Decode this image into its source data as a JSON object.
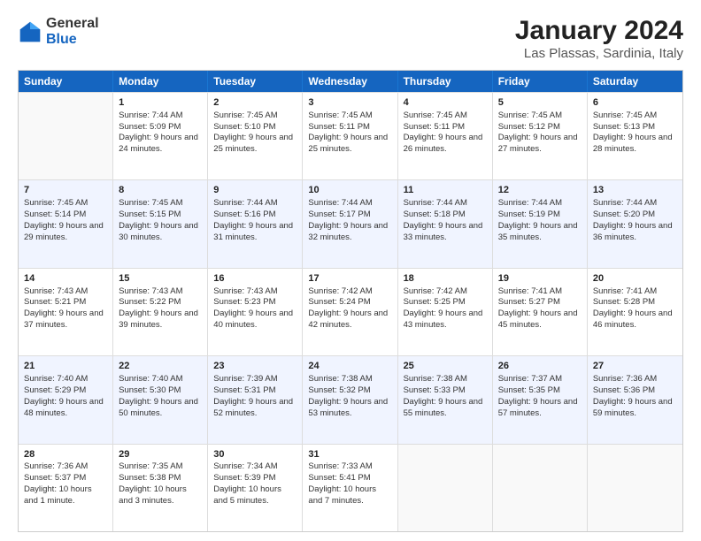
{
  "logo": {
    "general": "General",
    "blue": "Blue"
  },
  "title": "January 2024",
  "subtitle": "Las Plassas, Sardinia, Italy",
  "days": [
    "Sunday",
    "Monday",
    "Tuesday",
    "Wednesday",
    "Thursday",
    "Friday",
    "Saturday"
  ],
  "weeks": [
    [
      {
        "num": "",
        "empty": true
      },
      {
        "num": "1",
        "sunrise": "Sunrise: 7:44 AM",
        "sunset": "Sunset: 5:09 PM",
        "daylight": "Daylight: 9 hours and 24 minutes."
      },
      {
        "num": "2",
        "sunrise": "Sunrise: 7:45 AM",
        "sunset": "Sunset: 5:10 PM",
        "daylight": "Daylight: 9 hours and 25 minutes."
      },
      {
        "num": "3",
        "sunrise": "Sunrise: 7:45 AM",
        "sunset": "Sunset: 5:11 PM",
        "daylight": "Daylight: 9 hours and 25 minutes."
      },
      {
        "num": "4",
        "sunrise": "Sunrise: 7:45 AM",
        "sunset": "Sunset: 5:11 PM",
        "daylight": "Daylight: 9 hours and 26 minutes."
      },
      {
        "num": "5",
        "sunrise": "Sunrise: 7:45 AM",
        "sunset": "Sunset: 5:12 PM",
        "daylight": "Daylight: 9 hours and 27 minutes."
      },
      {
        "num": "6",
        "sunrise": "Sunrise: 7:45 AM",
        "sunset": "Sunset: 5:13 PM",
        "daylight": "Daylight: 9 hours and 28 minutes."
      }
    ],
    [
      {
        "num": "7",
        "sunrise": "Sunrise: 7:45 AM",
        "sunset": "Sunset: 5:14 PM",
        "daylight": "Daylight: 9 hours and 29 minutes."
      },
      {
        "num": "8",
        "sunrise": "Sunrise: 7:45 AM",
        "sunset": "Sunset: 5:15 PM",
        "daylight": "Daylight: 9 hours and 30 minutes."
      },
      {
        "num": "9",
        "sunrise": "Sunrise: 7:44 AM",
        "sunset": "Sunset: 5:16 PM",
        "daylight": "Daylight: 9 hours and 31 minutes."
      },
      {
        "num": "10",
        "sunrise": "Sunrise: 7:44 AM",
        "sunset": "Sunset: 5:17 PM",
        "daylight": "Daylight: 9 hours and 32 minutes."
      },
      {
        "num": "11",
        "sunrise": "Sunrise: 7:44 AM",
        "sunset": "Sunset: 5:18 PM",
        "daylight": "Daylight: 9 hours and 33 minutes."
      },
      {
        "num": "12",
        "sunrise": "Sunrise: 7:44 AM",
        "sunset": "Sunset: 5:19 PM",
        "daylight": "Daylight: 9 hours and 35 minutes."
      },
      {
        "num": "13",
        "sunrise": "Sunrise: 7:44 AM",
        "sunset": "Sunset: 5:20 PM",
        "daylight": "Daylight: 9 hours and 36 minutes."
      }
    ],
    [
      {
        "num": "14",
        "sunrise": "Sunrise: 7:43 AM",
        "sunset": "Sunset: 5:21 PM",
        "daylight": "Daylight: 9 hours and 37 minutes."
      },
      {
        "num": "15",
        "sunrise": "Sunrise: 7:43 AM",
        "sunset": "Sunset: 5:22 PM",
        "daylight": "Daylight: 9 hours and 39 minutes."
      },
      {
        "num": "16",
        "sunrise": "Sunrise: 7:43 AM",
        "sunset": "Sunset: 5:23 PM",
        "daylight": "Daylight: 9 hours and 40 minutes."
      },
      {
        "num": "17",
        "sunrise": "Sunrise: 7:42 AM",
        "sunset": "Sunset: 5:24 PM",
        "daylight": "Daylight: 9 hours and 42 minutes."
      },
      {
        "num": "18",
        "sunrise": "Sunrise: 7:42 AM",
        "sunset": "Sunset: 5:25 PM",
        "daylight": "Daylight: 9 hours and 43 minutes."
      },
      {
        "num": "19",
        "sunrise": "Sunrise: 7:41 AM",
        "sunset": "Sunset: 5:27 PM",
        "daylight": "Daylight: 9 hours and 45 minutes."
      },
      {
        "num": "20",
        "sunrise": "Sunrise: 7:41 AM",
        "sunset": "Sunset: 5:28 PM",
        "daylight": "Daylight: 9 hours and 46 minutes."
      }
    ],
    [
      {
        "num": "21",
        "sunrise": "Sunrise: 7:40 AM",
        "sunset": "Sunset: 5:29 PM",
        "daylight": "Daylight: 9 hours and 48 minutes."
      },
      {
        "num": "22",
        "sunrise": "Sunrise: 7:40 AM",
        "sunset": "Sunset: 5:30 PM",
        "daylight": "Daylight: 9 hours and 50 minutes."
      },
      {
        "num": "23",
        "sunrise": "Sunrise: 7:39 AM",
        "sunset": "Sunset: 5:31 PM",
        "daylight": "Daylight: 9 hours and 52 minutes."
      },
      {
        "num": "24",
        "sunrise": "Sunrise: 7:38 AM",
        "sunset": "Sunset: 5:32 PM",
        "daylight": "Daylight: 9 hours and 53 minutes."
      },
      {
        "num": "25",
        "sunrise": "Sunrise: 7:38 AM",
        "sunset": "Sunset: 5:33 PM",
        "daylight": "Daylight: 9 hours and 55 minutes."
      },
      {
        "num": "26",
        "sunrise": "Sunrise: 7:37 AM",
        "sunset": "Sunset: 5:35 PM",
        "daylight": "Daylight: 9 hours and 57 minutes."
      },
      {
        "num": "27",
        "sunrise": "Sunrise: 7:36 AM",
        "sunset": "Sunset: 5:36 PM",
        "daylight": "Daylight: 9 hours and 59 minutes."
      }
    ],
    [
      {
        "num": "28",
        "sunrise": "Sunrise: 7:36 AM",
        "sunset": "Sunset: 5:37 PM",
        "daylight": "Daylight: 10 hours and 1 minute."
      },
      {
        "num": "29",
        "sunrise": "Sunrise: 7:35 AM",
        "sunset": "Sunset: 5:38 PM",
        "daylight": "Daylight: 10 hours and 3 minutes."
      },
      {
        "num": "30",
        "sunrise": "Sunrise: 7:34 AM",
        "sunset": "Sunset: 5:39 PM",
        "daylight": "Daylight: 10 hours and 5 minutes."
      },
      {
        "num": "31",
        "sunrise": "Sunrise: 7:33 AM",
        "sunset": "Sunset: 5:41 PM",
        "daylight": "Daylight: 10 hours and 7 minutes."
      },
      {
        "num": "",
        "empty": true
      },
      {
        "num": "",
        "empty": true
      },
      {
        "num": "",
        "empty": true
      }
    ]
  ]
}
